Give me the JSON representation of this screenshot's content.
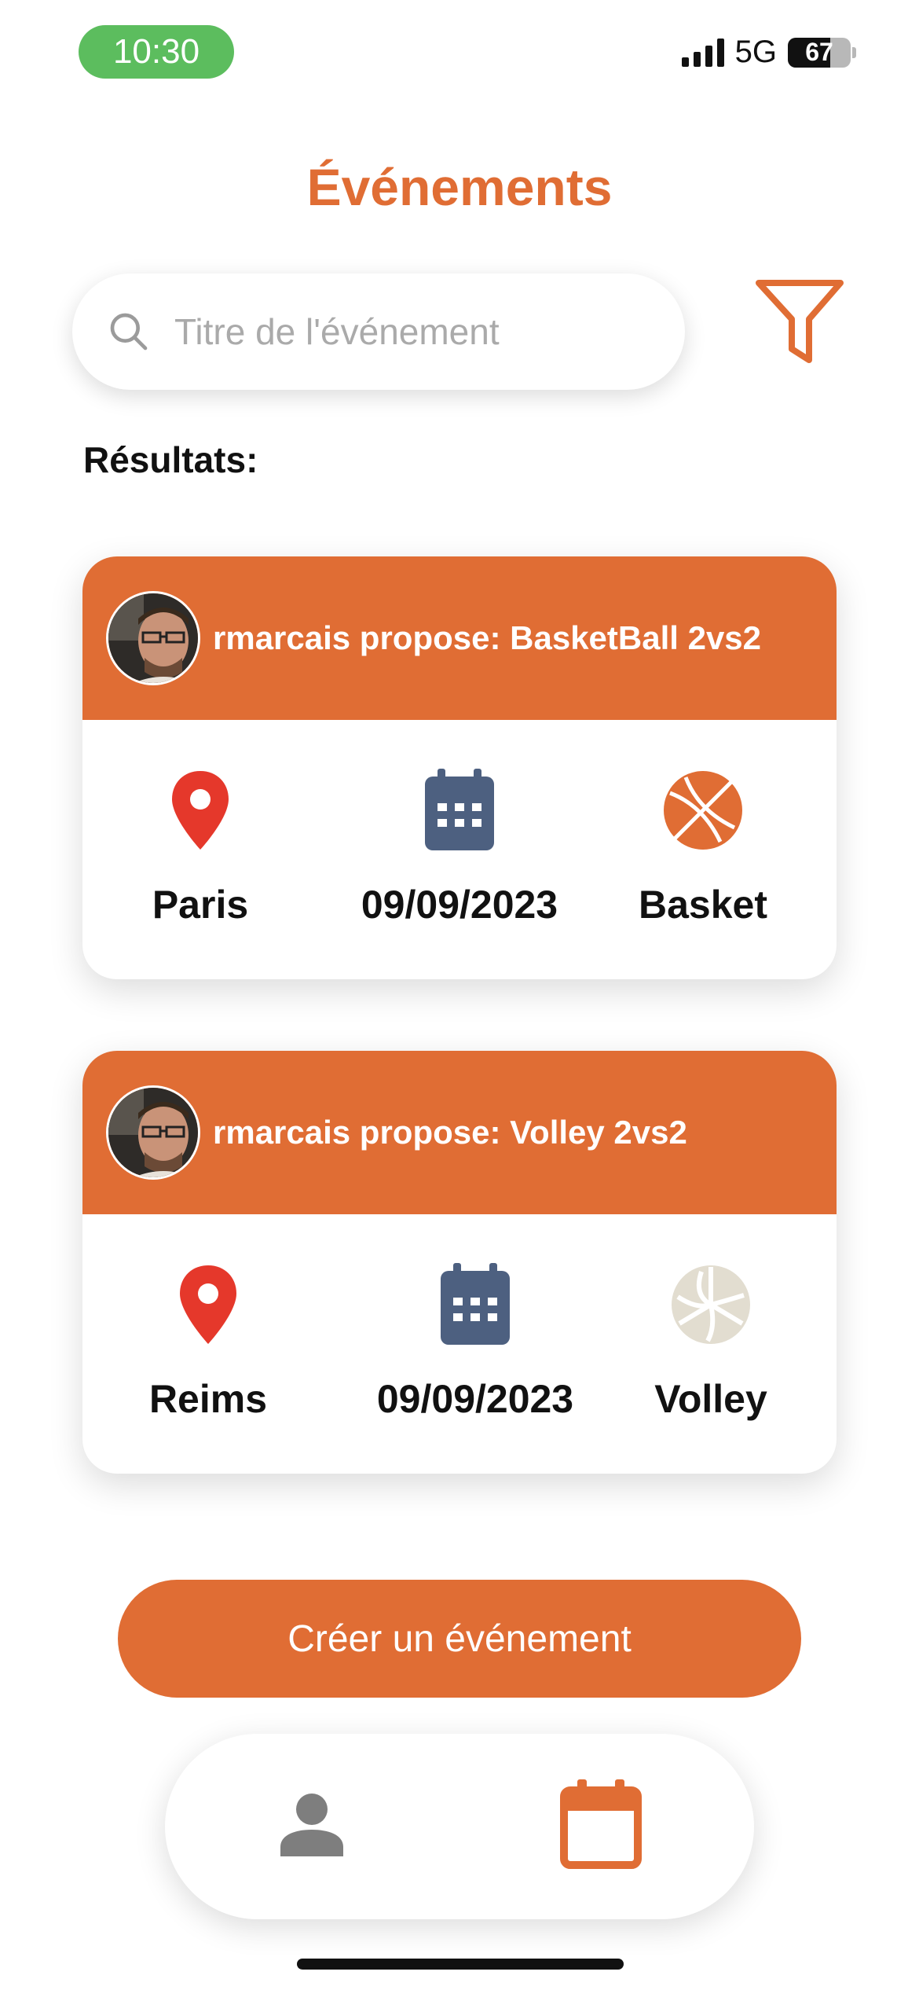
{
  "status_bar": {
    "time": "10:30",
    "network": "5G",
    "battery": 67
  },
  "header": {
    "title": "Événements"
  },
  "search": {
    "placeholder": "Titre de l'événement",
    "value": ""
  },
  "results": {
    "label": "Résultats:",
    "events": [
      {
        "title": "rmarcais propose: BasketBall 2vs2",
        "location": "Paris",
        "date": "09/09/2023",
        "sport": "Basket",
        "sport_icon": "basketball-icon"
      },
      {
        "title": "rmarcais propose: Volley 2vs2",
        "location": "Reims",
        "date": "09/09/2023",
        "sport": "Volley",
        "sport_icon": "volleyball-icon"
      }
    ]
  },
  "actions": {
    "create_label": "Créer un événement"
  },
  "bottom_nav": {
    "items": [
      {
        "icon": "person-icon",
        "active": false
      },
      {
        "icon": "calendar-icon",
        "active": true
      }
    ]
  },
  "colors": {
    "accent": "#e06d34",
    "location_pin": "#e5382b",
    "calendar": "#4d6080",
    "volleyball": "#e2ddd0",
    "status_green": "#5cbd5e"
  }
}
